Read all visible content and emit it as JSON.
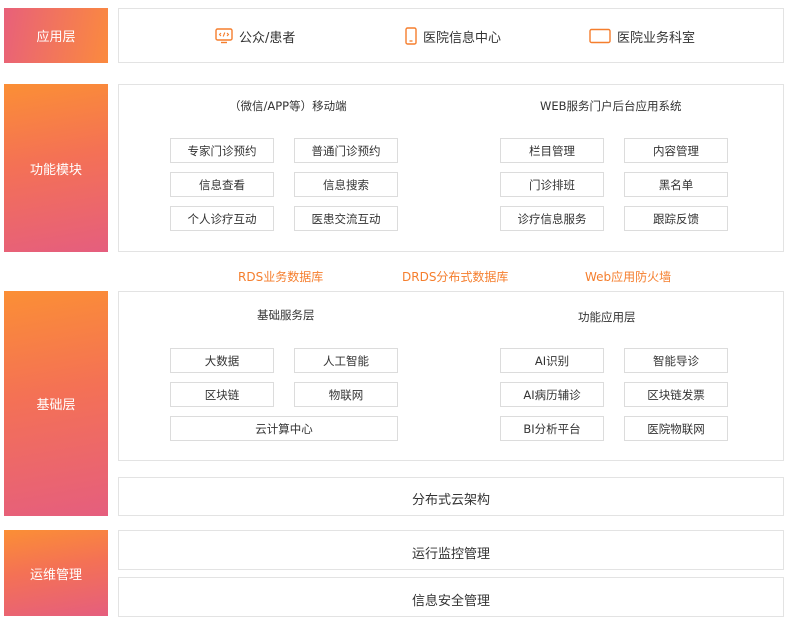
{
  "layers": {
    "app_layer": "应用层",
    "function_module": "功能模块",
    "base_layer": "基础层",
    "ops_management": "运维管理"
  },
  "app_entries": [
    {
      "label": "公众/患者",
      "icon": "monitor-code-icon"
    },
    {
      "label": "医院信息中心",
      "icon": "phone-icon"
    },
    {
      "label": "医院业务科室",
      "icon": "tablet-icon"
    }
  ],
  "function": {
    "mobile": {
      "title": "（微信/APP等）移动端",
      "items": [
        "专家门诊预约",
        "普通门诊预约",
        "信息查看",
        "信息搜索",
        "个人诊疗互动",
        "医患交流互动"
      ]
    },
    "web": {
      "title": "WEB服务门户后台应用系统",
      "items": [
        "栏目管理",
        "内容管理",
        "门诊排班",
        "黑名单",
        "诊疗信息服务",
        "跟踪反馈"
      ]
    }
  },
  "databases": [
    "RDS业务数据库",
    "DRDS分布式数据库",
    "Web应用防火墙"
  ],
  "base": {
    "service": {
      "title": "基础服务层",
      "items": [
        "大数据",
        "人工智能",
        "区块链",
        "物联网",
        "云计算中心"
      ]
    },
    "function": {
      "title": "功能应用层",
      "items": [
        "AI识别",
        "智能导诊",
        "AI病历辅诊",
        "区块链发票",
        "BI分析平台",
        "医院物联网"
      ]
    },
    "cloud": "分布式云架构"
  },
  "ops": {
    "monitoring": "运行监控管理",
    "security": "信息安全管理"
  },
  "colors": {
    "accent_orange": "#f57e2d",
    "gradient_start": "#e8607a",
    "gradient_end": "#fb8a3e"
  }
}
